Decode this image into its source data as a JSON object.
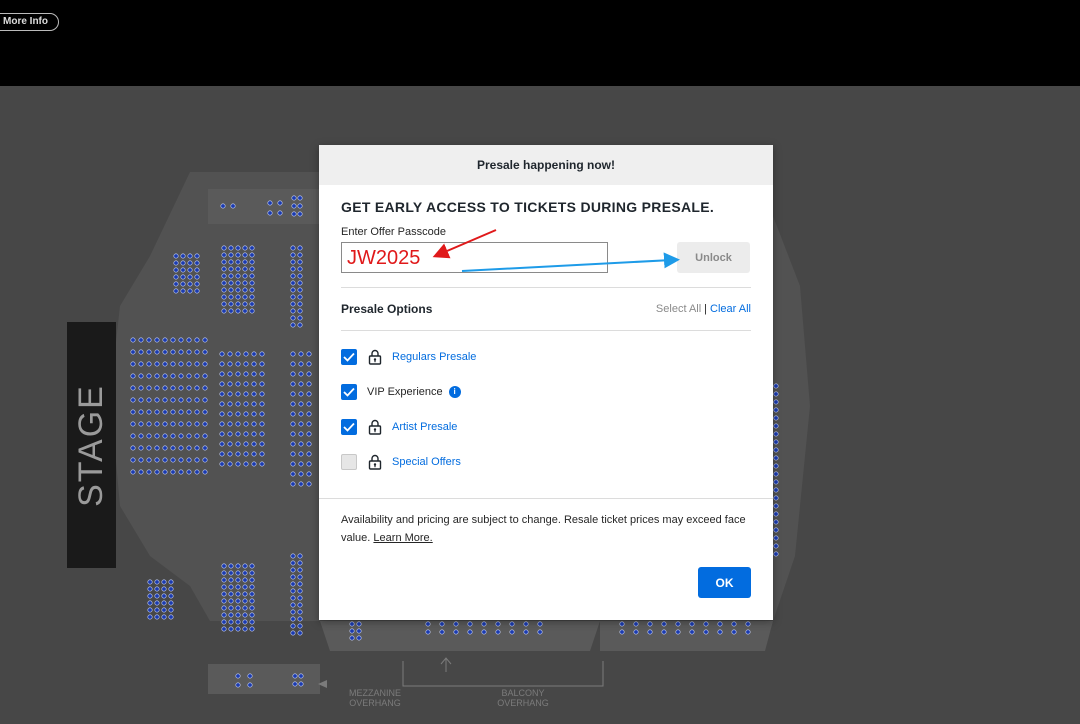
{
  "topbar": {
    "more_info_label": "More Info"
  },
  "venue": {
    "stage_label": "STAGE",
    "mezzanine_label": "MEZZANINE\nOVERHANG",
    "balcony_label": "BALCONY\nOVERHANG"
  },
  "modal": {
    "header": "Presale happening now!",
    "headline": "GET EARLY ACCESS TO TICKETS DURING PRESALE.",
    "passcode_label": "Enter Offer Passcode",
    "passcode_value": "JW2025",
    "unlock_label": "Unlock",
    "options_title": "Presale Options",
    "select_all": "Select All",
    "separator": "|",
    "clear_all": "Clear All",
    "options": [
      {
        "label": "Regulars Presale",
        "checked": true,
        "locked": true
      },
      {
        "label": "VIP Experience",
        "checked": true,
        "locked": false,
        "info": true
      },
      {
        "label": "Artist Presale",
        "checked": true,
        "locked": true
      },
      {
        "label": "Special Offers",
        "checked": false,
        "locked": true
      }
    ],
    "notice_text": "Availability and pricing are subject to change. Resale ticket prices may exceed face value.",
    "learn_more": "Learn More.",
    "ok_label": "OK",
    "info_glyph": "i"
  },
  "colors": {
    "accent": "#026cdf",
    "annotation_red": "#e0191a",
    "annotation_blue": "#1e9be8"
  }
}
